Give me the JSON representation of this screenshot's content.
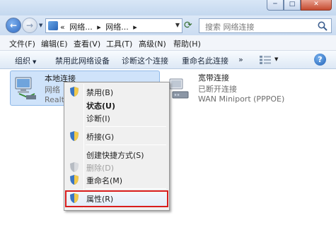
{
  "window": {
    "controls": [
      "─",
      "□",
      "✕"
    ]
  },
  "nav": {
    "back_icon": "back-arrow-icon",
    "forward_icon": "forward-arrow-icon",
    "address": {
      "prefix": "«",
      "crumbs": [
        "网络...",
        "网络..."
      ],
      "separator": "▸"
    },
    "search": {
      "placeholder": "搜索 网络连接"
    }
  },
  "menubar": {
    "items": [
      "文件(F)",
      "编辑(E)",
      "查看(V)",
      "工具(T)",
      "高级(N)",
      "帮助(H)"
    ]
  },
  "commandbar": {
    "organize": "组织",
    "disable": "禁用此网络设备",
    "diagnose": "诊断这个连接",
    "rename": "重命名此连接",
    "more": "»"
  },
  "connections": {
    "local": {
      "name": "本地连接",
      "status": "网络",
      "device": "Realte"
    },
    "broadband": {
      "name": "宽带连接",
      "status": "已断开连接",
      "device": "WAN Miniport (PPPOE)"
    }
  },
  "context_menu": {
    "items": [
      {
        "label": "禁用(B)",
        "shield": true
      },
      {
        "label": "状态(U)",
        "bold": true
      },
      {
        "label": "诊断(I)"
      },
      {
        "label": "桥接(G)",
        "shield": true
      },
      {
        "label": "创建快捷方式(S)"
      },
      {
        "label": "删除(D)",
        "shield": true,
        "disabled": true
      },
      {
        "label": "重命名(M)",
        "shield": true
      },
      {
        "label": "属性(R)",
        "shield": true,
        "highlighted": true
      }
    ],
    "highlight_color": "#d81d1d"
  },
  "colors": {
    "selection": "#cfe3fa",
    "accent": "#2f6ac1"
  }
}
